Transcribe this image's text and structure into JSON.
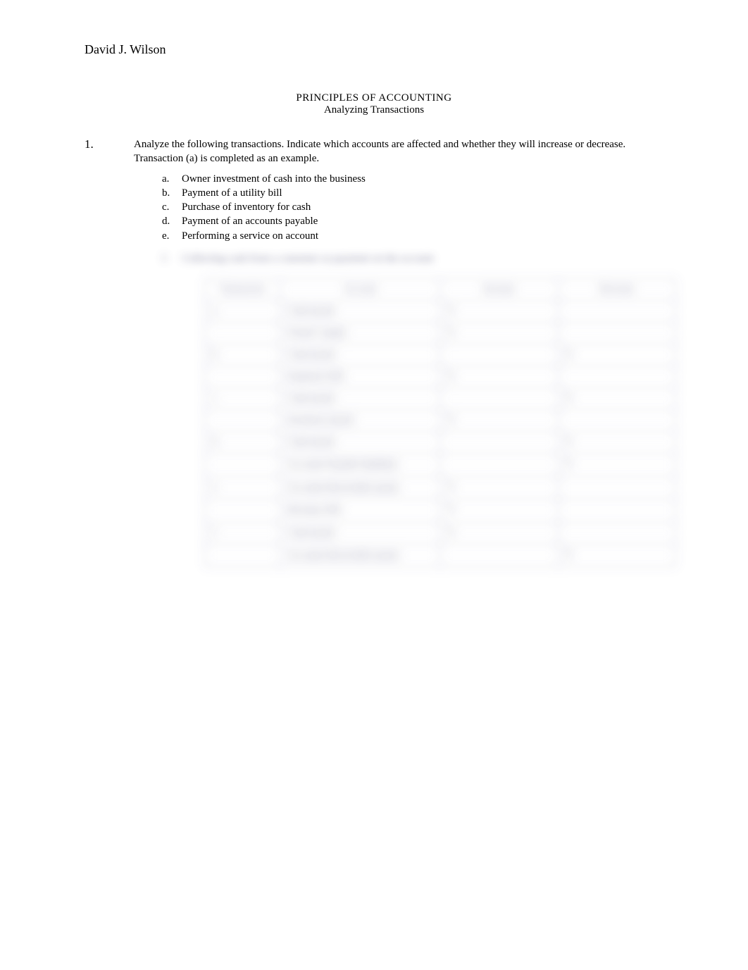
{
  "author": "David J. Wilson",
  "title_line1": "PRINCIPLES OF ACCOUNTING",
  "title_line2": "Analyzing Transactions",
  "question": {
    "number": "1.",
    "prompt": "Analyze the following transactions. Indicate which accounts are affected and whether they will increase or decrease. Transaction (a) is completed as an example."
  },
  "sub_items": [
    {
      "letter": "a.",
      "text": "Owner investment of cash into the business"
    },
    {
      "letter": "b.",
      "text": "Payment of a utility bill"
    },
    {
      "letter": "c.",
      "text": "Purchase of inventory for cash"
    },
    {
      "letter": "d.",
      "text": "Payment of an accounts payable"
    },
    {
      "letter": "e.",
      "text": "Performing a service on account"
    }
  ],
  "blurred_sub_item": {
    "letter": "f.",
    "text": "Collecting cash from a customer as payment on the account"
  },
  "table": {
    "headers": [
      "Transaction",
      "Account",
      "Increase",
      "Decrease"
    ],
    "rows": [
      {
        "t": "a.",
        "acc": "Cash (asset)",
        "inc": "X",
        "dec": ""
      },
      {
        "t": "",
        "acc": "Owner's equity",
        "inc": "X",
        "dec": ""
      },
      {
        "t": "b.",
        "acc": "Cash (asset)",
        "inc": "",
        "dec": "X"
      },
      {
        "t": "",
        "acc": "Expenses (NI)",
        "inc": "X",
        "dec": ""
      },
      {
        "t": "c.",
        "acc": "Cash (asset)",
        "inc": "",
        "dec": "X"
      },
      {
        "t": "",
        "acc": "Inventory (asset)",
        "inc": "X",
        "dec": ""
      },
      {
        "t": "d.",
        "acc": "Cash (asset)",
        "inc": "",
        "dec": "X"
      },
      {
        "t": "",
        "acc": "Accounts Payable (liability)",
        "inc": "",
        "dec": "X"
      },
      {
        "t": "e.",
        "acc": "Accounts Receivable (asset)",
        "inc": "X",
        "dec": ""
      },
      {
        "t": "",
        "acc": "Revenue (NI)",
        "inc": "X",
        "dec": ""
      },
      {
        "t": "f.",
        "acc": "Cash (asset)",
        "inc": "X",
        "dec": ""
      },
      {
        "t": "",
        "acc": "Accounts Receivable (asset)",
        "inc": "",
        "dec": "X"
      }
    ]
  }
}
